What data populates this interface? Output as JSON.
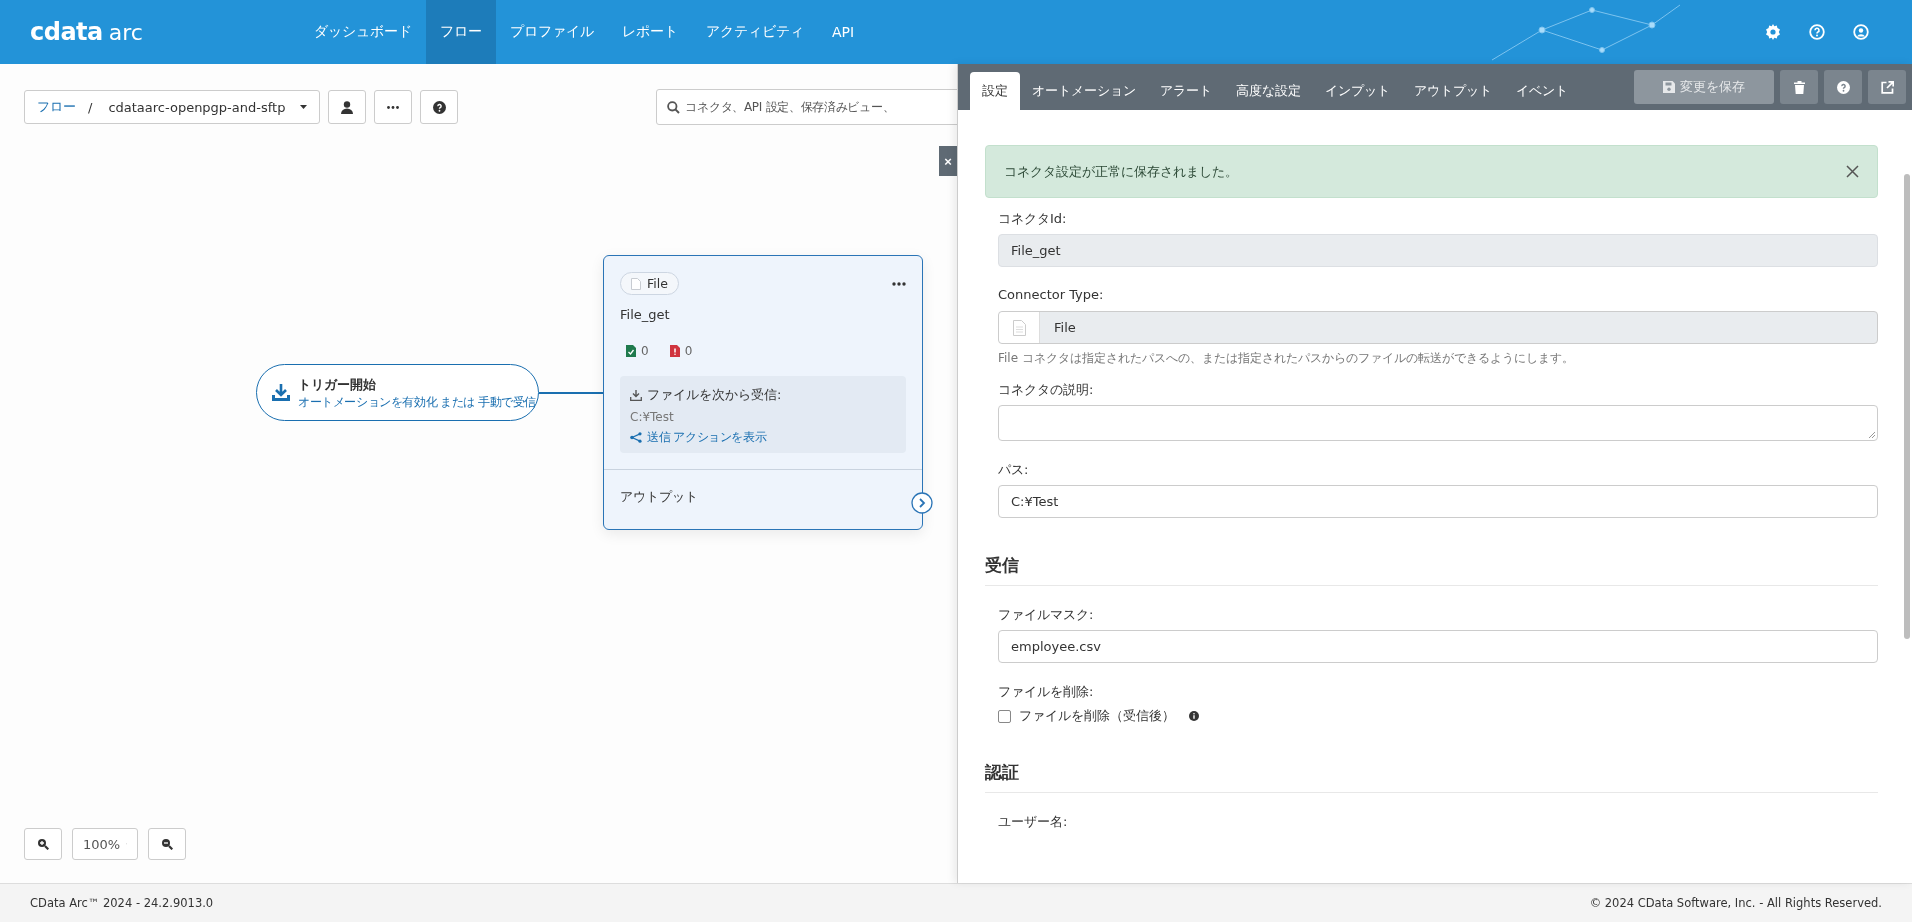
{
  "header": {
    "logo_main": "cdata",
    "logo_sub": "arc",
    "nav": [
      {
        "label": "ダッシュボード",
        "selected": false
      },
      {
        "label": "フロー",
        "selected": true
      },
      {
        "label": "プロファイル",
        "selected": false
      },
      {
        "label": "レポート",
        "selected": false
      },
      {
        "label": "アクティビティ",
        "selected": false
      },
      {
        "label": "API",
        "selected": false
      }
    ]
  },
  "toolbar": {
    "breadcrumb_root": "フロー",
    "separator": "/",
    "flow_name": "cdataarc-openpgp-and-sftp",
    "search": {
      "placeholder": "コネクタ、API 設定、保存済みビュー、"
    }
  },
  "canvas": {
    "close_button": "×",
    "trigger": {
      "title": "トリガー開始",
      "link_1": "オートメーションを有効化",
      "joiner": "または",
      "link_2": "手動で受信"
    },
    "node": {
      "badge": "File",
      "name": "File_get",
      "success_count": "0",
      "error_count": "0",
      "receive_label": "ファイルを次から受信:",
      "receive_path": "C:¥Test",
      "send_link": "送信 アクションを表示",
      "output_label": "アウトプット"
    },
    "zoom": "100%"
  },
  "panel": {
    "tabs": [
      {
        "label": "設定",
        "selected": true
      },
      {
        "label": "オートメーション",
        "selected": false
      },
      {
        "label": "アラート",
        "selected": false
      },
      {
        "label": "高度な設定",
        "selected": false
      },
      {
        "label": "インプット",
        "selected": false
      },
      {
        "label": "アウトプット",
        "selected": false
      },
      {
        "label": "イベント",
        "selected": false
      }
    ],
    "save_button": {
      "label": "変更を保存",
      "disabled": true
    },
    "alert": "コネクタ設定が正常に保存されました。",
    "fields": [
      {
        "kind": "readonly",
        "label": "コネクタId:",
        "value": "File_get"
      },
      {
        "kind": "type",
        "label": "Connector Type:",
        "value": "File",
        "hint": "File コネクタは指定されたパスへの、または指定されたパスからのファイルの転送ができるようにします。"
      },
      {
        "kind": "textarea",
        "label": "コネクタの説明:"
      },
      {
        "kind": "text",
        "label": "パス:",
        "value": "C:¥Test"
      },
      {
        "kind": "heading",
        "label": "受信"
      },
      {
        "kind": "text",
        "label": "ファイルマスク:",
        "value": "employee.csv"
      },
      {
        "kind": "checkbox",
        "label": "ファイルを削除:",
        "option": "ファイルを削除（受信後）",
        "checked": false
      },
      {
        "kind": "heading",
        "label": "認証"
      },
      {
        "kind": "label",
        "label": "ユーザー名:"
      }
    ]
  },
  "footer": {
    "version": "CData Arc™ 2024 - 24.2.9013.0",
    "copyright": "© 2024 CData Software, Inc. - All Rights Reserved."
  }
}
